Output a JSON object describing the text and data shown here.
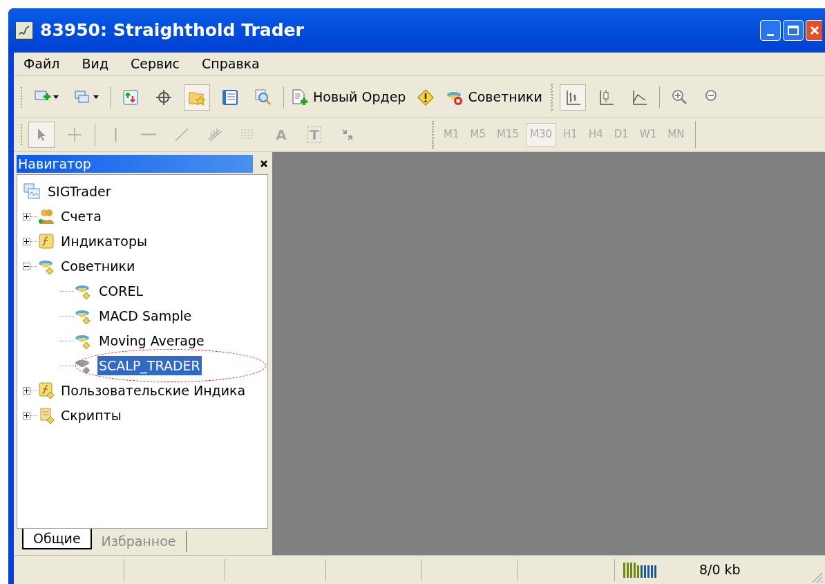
{
  "window": {
    "title": "83950: Straighthold Trader"
  },
  "menu": [
    "Файл",
    "Вид",
    "Сервис",
    "Справка"
  ],
  "toolbar": [
    {
      "kind": "icon",
      "pressed": false
    },
    {
      "kind": "icon",
      "pressed": false
    },
    {
      "kind": "sep"
    },
    {
      "kind": "icon",
      "pressed": false
    },
    {
      "kind": "icon",
      "pressed": false
    },
    {
      "kind": "icon",
      "pressed": true
    },
    {
      "kind": "icon",
      "pressed": false
    },
    {
      "kind": "icon",
      "pressed": false
    },
    {
      "kind": "sep"
    },
    {
      "kind": "text",
      "label": "Новый Ордер"
    },
    {
      "kind": "icon",
      "pressed": false
    },
    {
      "kind": "text",
      "label": "Советники"
    },
    {
      "kind": "grip"
    },
    {
      "kind": "icon",
      "pressed": true
    },
    {
      "kind": "icon",
      "pressed": false
    },
    {
      "kind": "icon",
      "pressed": false
    },
    {
      "kind": "sep"
    },
    {
      "kind": "icon",
      "pressed": false
    },
    {
      "kind": "icon",
      "pressed": false
    }
  ],
  "drawing_tools": [
    {
      "kind": "icon",
      "pressed": true
    },
    {
      "kind": "icon",
      "pressed": false
    },
    {
      "kind": "sep"
    },
    {
      "kind": "icon",
      "pressed": false
    },
    {
      "kind": "icon",
      "pressed": false
    },
    {
      "kind": "icon",
      "pressed": false
    },
    {
      "kind": "icon",
      "pressed": false
    },
    {
      "kind": "icon",
      "pressed": false
    },
    {
      "kind": "text",
      "label": "A",
      "pressed": false
    },
    {
      "kind": "text",
      "label": "T",
      "pressed": false
    },
    {
      "kind": "icon",
      "pressed": false
    }
  ],
  "timeframes": [
    {
      "label": "M1",
      "selected": false
    },
    {
      "label": "M5",
      "selected": false
    },
    {
      "label": "M15",
      "selected": false
    },
    {
      "label": "M30",
      "selected": true
    },
    {
      "label": "H1",
      "selected": false
    },
    {
      "label": "H4",
      "selected": false
    },
    {
      "label": "D1",
      "selected": false
    },
    {
      "label": "W1",
      "selected": false
    },
    {
      "label": "MN",
      "selected": false
    }
  ],
  "navigator": {
    "title": "Навигатор",
    "root": {
      "label": "SIGTrader",
      "children": [
        {
          "label": "Счета",
          "expanded": false
        },
        {
          "label": "Индикаторы",
          "expanded": false
        },
        {
          "label": "Советники",
          "expanded": true,
          "children": [
            {
              "label": "COREL",
              "active": true,
              "selected": false,
              "circled": false
            },
            {
              "label": "MACD Sample",
              "active": true,
              "selected": false,
              "circled": false
            },
            {
              "label": "Moving Average",
              "active": true,
              "selected": false,
              "circled": false
            },
            {
              "label": "SCALP_TRADER",
              "active": false,
              "selected": true,
              "circled": true
            }
          ]
        },
        {
          "label": "Пользовательские Индика",
          "expanded": false
        },
        {
          "label": "Скрипты",
          "expanded": false
        }
      ]
    },
    "tabs": [
      {
        "label": "Общие",
        "selected": true
      },
      {
        "label": "Избранное",
        "selected": false
      }
    ]
  },
  "status_bar": {
    "traffic": "8/0 kb"
  }
}
